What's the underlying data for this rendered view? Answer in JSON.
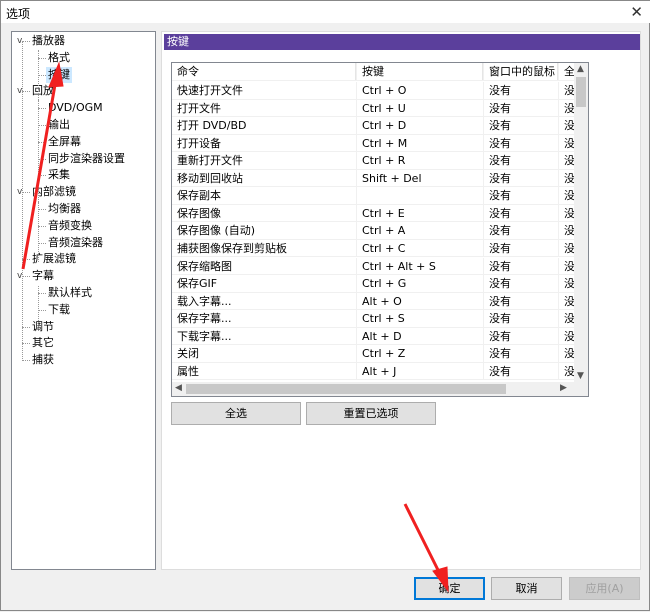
{
  "window": {
    "title": "选项",
    "close": "✕"
  },
  "tree": [
    {
      "label": "播放器",
      "level": 0,
      "expanded": true
    },
    {
      "label": "格式",
      "level": 1
    },
    {
      "label": "按键",
      "level": 1,
      "selected": true
    },
    {
      "label": "回放",
      "level": 0,
      "expanded": true
    },
    {
      "label": "DVD/OGM",
      "level": 1
    },
    {
      "label": "输出",
      "level": 1
    },
    {
      "label": "全屏幕",
      "level": 1
    },
    {
      "label": "同步渲染器设置",
      "level": 1
    },
    {
      "label": "采集",
      "level": 1
    },
    {
      "label": "内部滤镜",
      "level": 0,
      "expanded": true
    },
    {
      "label": "均衡器",
      "level": 1
    },
    {
      "label": "音频变换",
      "level": 1
    },
    {
      "label": "音频渲染器",
      "level": 1
    },
    {
      "label": "扩展滤镜",
      "level": 0
    },
    {
      "label": "字幕",
      "level": 0,
      "expanded": true
    },
    {
      "label": "默认样式",
      "level": 1
    },
    {
      "label": "下载",
      "level": 1
    },
    {
      "label": "调节",
      "level": 0
    },
    {
      "label": "其它",
      "level": 0
    },
    {
      "label": "捕获",
      "level": 0
    }
  ],
  "panel": {
    "title": "按键",
    "header_color": "#5b3f9c"
  },
  "table": {
    "columns": [
      "命令",
      "按键",
      "窗口中的鼠标",
      "全"
    ],
    "rows": [
      [
        "快速打开文件",
        "Ctrl + O",
        "没有",
        "没"
      ],
      [
        "打开文件",
        "Ctrl + U",
        "没有",
        "没"
      ],
      [
        "打开 DVD/BD",
        "Ctrl + D",
        "没有",
        "没"
      ],
      [
        "打开设备",
        "Ctrl + M",
        "没有",
        "没"
      ],
      [
        "重新打开文件",
        "Ctrl + R",
        "没有",
        "没"
      ],
      [
        "移动到回收站",
        "Shift + Del",
        "没有",
        "没"
      ],
      [
        "保存副本",
        "",
        "没有",
        "没"
      ],
      [
        "保存图像",
        "Ctrl + E",
        "没有",
        "没"
      ],
      [
        "保存图像 (自动)",
        "Ctrl + A",
        "没有",
        "没"
      ],
      [
        "捕获图像保存到剪贴板",
        "Ctrl + C",
        "没有",
        "没"
      ],
      [
        "保存缩略图",
        "Ctrl + Alt + S",
        "没有",
        "没"
      ],
      [
        "保存GIF",
        "Ctrl + G",
        "没有",
        "没"
      ],
      [
        "载入字幕...",
        "Alt + O",
        "没有",
        "没"
      ],
      [
        "保存字幕...",
        "Ctrl + S",
        "没有",
        "没"
      ],
      [
        "下载字幕...",
        "Alt + D",
        "没有",
        "没"
      ],
      [
        "关闭",
        "Ctrl + Z",
        "没有",
        "没"
      ],
      [
        "属性",
        "Alt + J",
        "没有",
        "没"
      ]
    ]
  },
  "buttons": {
    "select_all": "全选",
    "reset": "重置已选项",
    "ok": "确定",
    "cancel": "取消",
    "apply": "应用(A)"
  }
}
